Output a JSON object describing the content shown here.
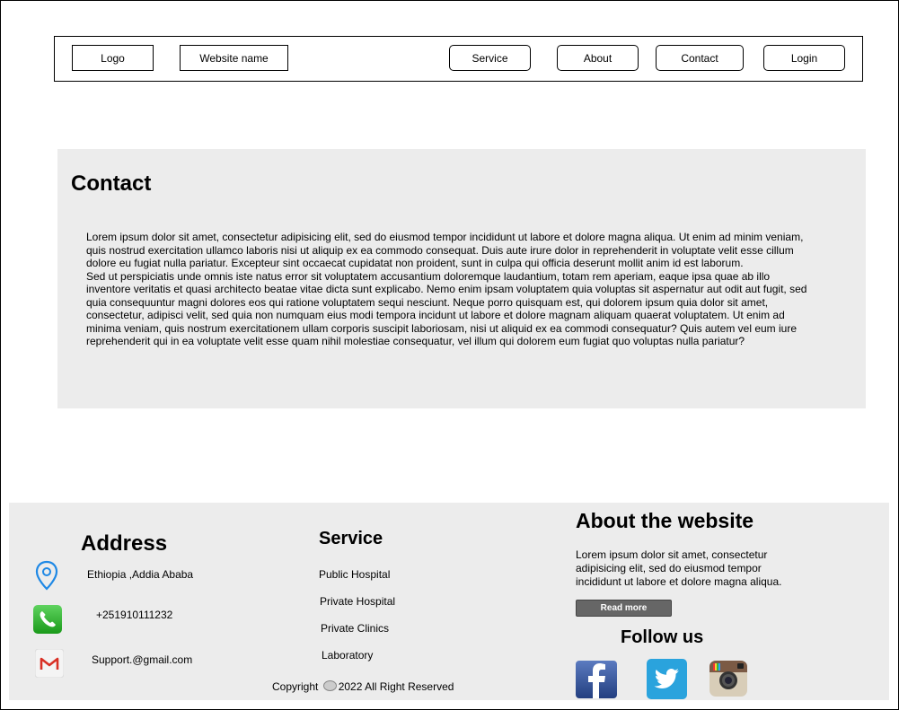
{
  "nav": {
    "logo": "Logo",
    "website_name": "Website name",
    "items": [
      "Service",
      "About",
      "Contact",
      "Login"
    ]
  },
  "contact": {
    "title": "Contact",
    "paragraph_1": "Lorem ipsum dolor sit amet, consectetur adipisicing elit, sed do eiusmod tempor incididunt ut labore et dolore magna aliqua. Ut enim ad minim veniam, quis nostrud exercitation ullamco laboris nisi ut aliquip ex ea commodo consequat. Duis aute irure dolor in reprehenderit in voluptate velit esse cillum dolore eu fugiat nulla pariatur. Excepteur sint occaecat cupidatat non proident, sunt in culpa qui officia deserunt mollit anim id est laborum.",
    "paragraph_2": "Sed ut perspiciatis unde omnis iste natus error sit voluptatem accusantium doloremque laudantium, totam rem aperiam, eaque ipsa quae ab illo inventore veritatis et quasi architecto beatae vitae dicta sunt explicabo. Nemo enim ipsam voluptatem quia voluptas sit aspernatur aut odit aut fugit, sed quia consequuntur magni dolores eos qui ratione voluptatem sequi nesciunt. Neque porro quisquam est, qui dolorem ipsum quia dolor sit amet, consectetur, adipisci velit, sed quia non numquam eius modi tempora incidunt ut labore et dolore magnam aliquam quaerat voluptatem. Ut enim ad minima veniam, quis nostrum exercitationem ullam corporis suscipit laboriosam, nisi ut aliquid ex ea commodi consequatur? Quis autem vel eum iure reprehenderit qui in ea voluptate velit esse quam nihil molestiae consequatur, vel illum qui dolorem eum fugiat quo voluptas nulla pariatur?"
  },
  "footer": {
    "address": {
      "title": "Address",
      "location": "Ethiopia ,Addia Ababa",
      "phone": "+251910111232",
      "email": "Support.@gmail.com",
      "icons": [
        "location-pin-icon",
        "phone-icon",
        "gmail-icon"
      ]
    },
    "service": {
      "title": "Service",
      "items": [
        "Public Hospital",
        "Private Hospital",
        "Private Clinics",
        "Laboratory"
      ]
    },
    "about": {
      "title": "About the website",
      "text": "Lorem ipsum dolor sit amet, consectetur adipisicing elit, sed do eiusmod tempor incididunt ut labore et dolore magna aliqua.",
      "read_more": "Read more"
    },
    "follow": {
      "title": "Follow us",
      "icons": [
        "facebook-icon",
        "twitter-icon",
        "instagram-icon"
      ]
    },
    "copyright_before": "Copyright",
    "copyright_after": "2022 All Right Reserved"
  },
  "colors": {
    "panel_bg": "#ececec",
    "pin_blue": "#1e88e5",
    "phone_green": "#22a722",
    "gmail_red": "#d93025",
    "facebook_blue": "#2d4d8f",
    "twitter_blue": "#2aa3dd",
    "readmore_gray": "#666666"
  }
}
